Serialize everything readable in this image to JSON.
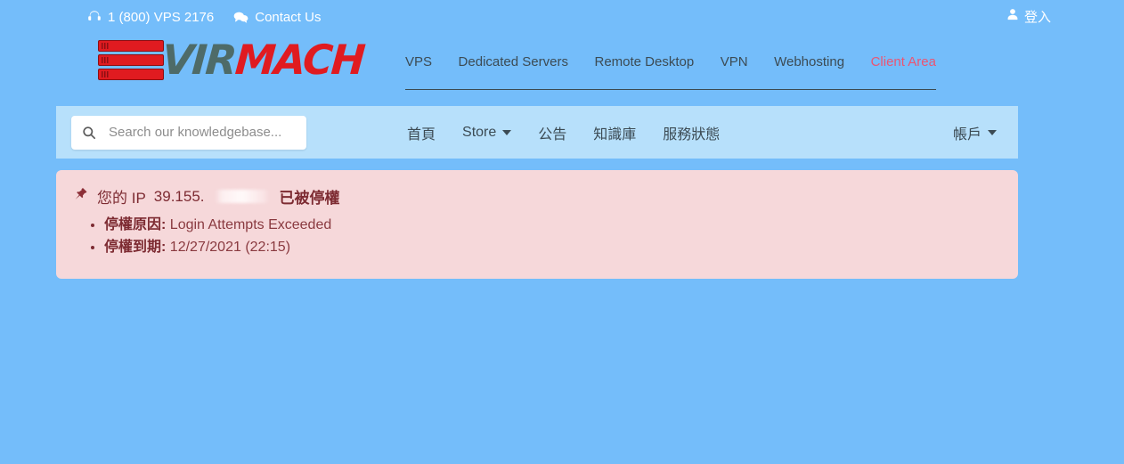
{
  "topbar": {
    "phone": "1 (800) VPS 2176",
    "phone_icon": "headset-icon",
    "contact": "Contact Us",
    "contact_icon": "comments-icon",
    "login": "登入",
    "login_icon": "user-icon"
  },
  "brand": {
    "name_part1": "VIR",
    "name_part2": "MACH",
    "color_dark": "#4e6b68",
    "color_red": "#e01b20"
  },
  "mainnav": {
    "items": [
      {
        "label": "VPS",
        "accent": false
      },
      {
        "label": "Dedicated Servers",
        "accent": false
      },
      {
        "label": "Remote Desktop",
        "accent": false
      },
      {
        "label": "VPN",
        "accent": false
      },
      {
        "label": "Webhosting",
        "accent": false
      },
      {
        "label": "Client Area",
        "accent": true
      }
    ],
    "accent_color": "#eb5573"
  },
  "search": {
    "placeholder": "Search our knowledgebase...",
    "value": "",
    "icon": "search-icon"
  },
  "subnav": {
    "items": [
      {
        "label": "首頁",
        "caret": false
      },
      {
        "label": "Store",
        "caret": true
      },
      {
        "label": "公告",
        "caret": false
      },
      {
        "label": "知識庫",
        "caret": false
      },
      {
        "label": "服務狀態",
        "caret": false
      }
    ],
    "account": {
      "label": "帳戶",
      "caret": true
    }
  },
  "alert": {
    "icon": "thumbtack-icon",
    "title_prefix": "您的 IP",
    "ip_visible": "39.155.",
    "ip_redacted": true,
    "title_suffix": "已被停權",
    "background_color": "#f6d8da",
    "text_color": "#7d2b32",
    "details": [
      {
        "key": "停權原因:",
        "value": "Login Attempts Exceeded"
      },
      {
        "key": "停權到期:",
        "value": "12/27/2021 (22:15)"
      }
    ]
  }
}
